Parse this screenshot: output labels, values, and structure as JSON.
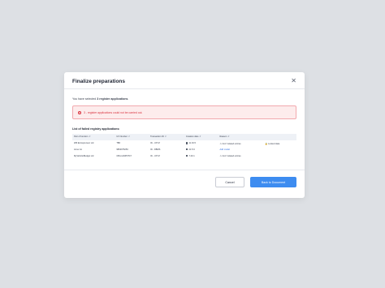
{
  "modal": {
    "title": "Finalize preparations",
    "close_glyph": "✕",
    "intro_prefix": "You have selected ",
    "intro_bold": "3 register applications",
    "intro_suffix": ".",
    "alert_icon": "!",
    "alert_text": "3 - register applications could not be carried out.",
    "list_label": "List of failed registry applications:"
  },
  "table": {
    "headers": [
      "Part of function",
      "UV Number",
      "Transaction ID",
      "Creation date",
      "Reason",
      ""
    ],
    "rows": [
      {
        "name": "Will Entrepreneur Ltd",
        "uv": "TBF",
        "tx": "ID - UXYZ",
        "date": "11.04.5",
        "reason": "Ann't related entries",
        "extra": "Locked data",
        "reason_link": false
      },
      {
        "name": "Anne Co",
        "uv": "9863975253",
        "tx": "ID - DBMS",
        "date": "21.5.9",
        "reason": "Add model",
        "extra": "",
        "reason_link": true
      },
      {
        "name": "MyVehicleBudget Ltd",
        "uv": "CBnvv94PNT47",
        "tx": "ID - UXYZ",
        "date": "7.20.1",
        "reason": "Ann't related entries",
        "extra": "",
        "reason_link": false
      }
    ]
  },
  "footer": {
    "cancel_label": "Cancel",
    "primary_label": "Back to Document"
  },
  "colors": {
    "background": "#dde0e4",
    "primary": "#3d8cf0",
    "error": "#d9333f",
    "error_bg": "#fdecec"
  }
}
